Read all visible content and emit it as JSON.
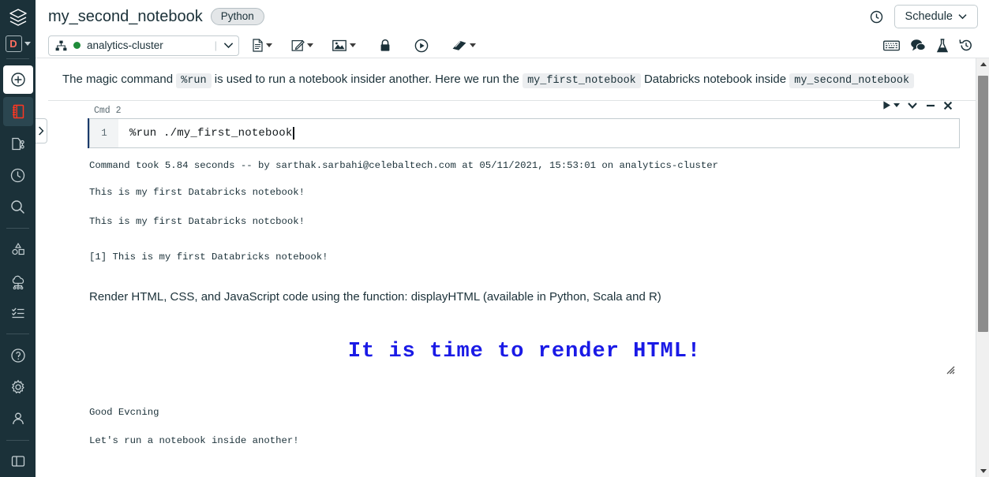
{
  "header": {
    "notebook_title": "my_second_notebook",
    "language_badge": "Python",
    "clock_icon": "clock-icon",
    "schedule_label": "Schedule",
    "schedule_caret": "∨"
  },
  "toolbar": {
    "cluster_icon": "cluster-icon",
    "cluster_name": "analytics-cluster",
    "cluster_status": "running",
    "cluster_status_color": "#1f8c3a",
    "select_divider": "|",
    "dropdown_caret": "∨",
    "buttons": [
      {
        "name": "file-menu",
        "icon": "file-icon",
        "caret": true
      },
      {
        "name": "edit-menu",
        "icon": "edit-pencil-icon",
        "caret": true
      },
      {
        "name": "view-menu",
        "icon": "image-icon",
        "caret": true
      },
      {
        "name": "permissions",
        "icon": "lock-icon",
        "caret": false
      },
      {
        "name": "run-all",
        "icon": "play-circle-icon",
        "caret": false
      },
      {
        "name": "clear-menu",
        "icon": "eraser-icon",
        "caret": true
      }
    ],
    "right_buttons": [
      {
        "name": "keyboard-shortcuts",
        "icon": "keyboard-icon"
      },
      {
        "name": "comments",
        "icon": "comment-icon"
      },
      {
        "name": "experiments",
        "icon": "flask-icon"
      },
      {
        "name": "revision-history",
        "icon": "history-icon"
      }
    ]
  },
  "sidebar": {
    "logo_icon": "databricks-logo-icon",
    "persona_letter": "D",
    "persona_caret_icon": "chevron-down-icon",
    "items": [
      {
        "name": "sidebar-item-create",
        "icon": "plus-circle-icon",
        "state": "white"
      },
      {
        "name": "sidebar-item-workspace",
        "icon": "notebook-icon",
        "state": "active"
      },
      {
        "name": "sidebar-item-repos",
        "icon": "repos-icon",
        "state": "normal"
      },
      {
        "name": "sidebar-item-recents",
        "icon": "clock-icon",
        "state": "normal"
      },
      {
        "name": "sidebar-item-search",
        "icon": "search-icon",
        "state": "normal"
      },
      {
        "name": "sidebar-item-data",
        "icon": "shapes-icon",
        "state": "normal"
      },
      {
        "name": "sidebar-item-compute",
        "icon": "compute-icon",
        "state": "normal"
      },
      {
        "name": "sidebar-item-jobs",
        "icon": "checklist-icon",
        "state": "normal"
      },
      {
        "name": "sidebar-item-help",
        "icon": "question-circle-icon",
        "state": "normal"
      },
      {
        "name": "sidebar-item-settings",
        "icon": "gear-icon",
        "state": "normal"
      },
      {
        "name": "sidebar-item-account",
        "icon": "user-icon",
        "state": "normal"
      },
      {
        "name": "sidebar-item-panel",
        "icon": "panel-toggle-icon",
        "state": "normal"
      }
    ]
  },
  "content": {
    "collapse_handle_icon": "chevron-right-icon",
    "markdown": {
      "part1": "The magic command ",
      "code1": "%run",
      "part2": " is used to run a notebook insider another. Here we run the ",
      "code2": "my_first_notebook",
      "part3": " Databricks notebook inside ",
      "code3": "my_second_notebook"
    },
    "cell": {
      "cmd_label": "Cmd 2",
      "line_number": "1",
      "code": "%run ./my_first_notebook",
      "actions": [
        {
          "name": "run-cell-button",
          "icon": "play-icon",
          "caret": true
        },
        {
          "name": "cell-menu-button",
          "icon": "chevron-down-icon",
          "caret": false
        },
        {
          "name": "minimize-cell-button",
          "icon": "minus-icon",
          "caret": false
        },
        {
          "name": "close-cell-button",
          "icon": "close-x-icon",
          "caret": false
        }
      ]
    },
    "output": {
      "meta": "Command took 5.84 seconds -- by sarthak.sarbahi@celebaltech.com at 05/11/2021, 15:53:01 on analytics-cluster",
      "lines": [
        "This is my first Databricks notebook!",
        "This is my first Databricks notcbook!",
        "[1] This is my first Databricks notebook!"
      ],
      "html_description": "Render HTML, CSS, and JavaScript code using the function: displayHTML (available in Python, Scala and R)",
      "html_heading": "It is time to render HTML!",
      "html_heading_color": "#1a1ae6",
      "resize_grip_icon": "resize-grip-icon",
      "tail_lines": [
        "Good Evcning",
        "Let's run a notebook inside another!"
      ]
    }
  },
  "scrollbar": {
    "up_arrow_icon": "triangle-up-icon",
    "down_arrow_icon": "triangle-down-icon",
    "thumb_name": "scrollbar-thumb"
  }
}
